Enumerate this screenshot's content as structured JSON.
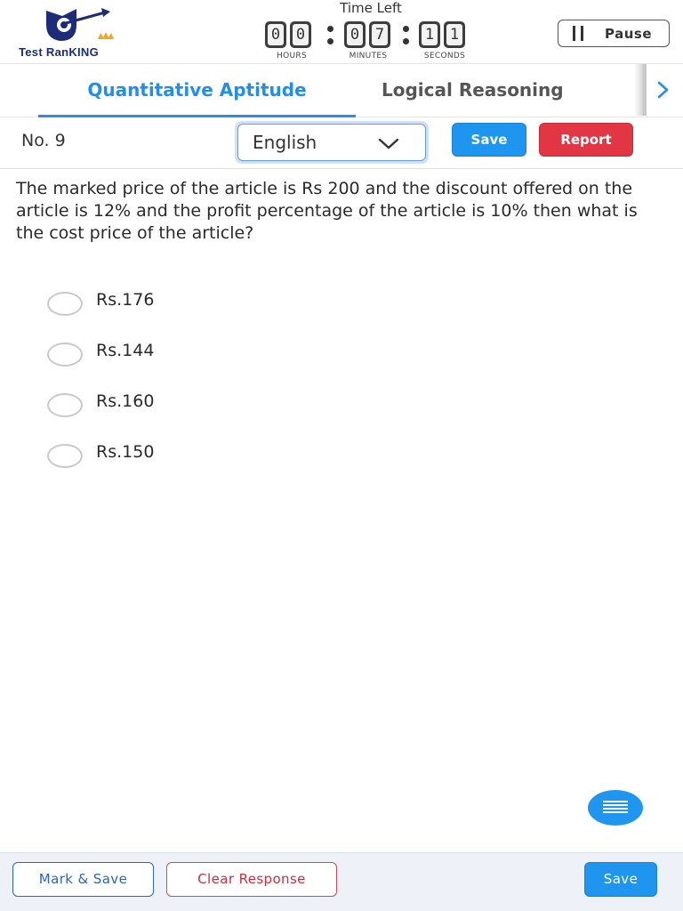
{
  "header": {
    "logo_text": "Test RanKING",
    "logo_icon": "target-arrow-logo",
    "timer": {
      "label": "Time Left",
      "hours": [
        "0",
        "0"
      ],
      "minutes": [
        "0",
        "7"
      ],
      "seconds": [
        "1",
        "1"
      ],
      "hours_label": "HOURS",
      "minutes_label": "MINUTES",
      "seconds_label": "SECONDS"
    },
    "pause_label": "Pause"
  },
  "tabs": {
    "items": [
      {
        "label": "Quantitative Aptitude",
        "active": true
      },
      {
        "label": "Logical Reasoning",
        "active": false
      }
    ],
    "next_icon": "chevron-right-icon"
  },
  "question_bar": {
    "number": "No. 9",
    "language": "English",
    "save_label": "Save",
    "report_label": "Report"
  },
  "question": {
    "text": "The marked price of the article is Rs 200 and the discount offered on the article is 12% and the profit percentage of the article is 10% then what is the cost price of the article?",
    "options": [
      "Rs.176",
      "Rs.144",
      "Rs.160",
      "Rs.150"
    ]
  },
  "footer": {
    "mark_save_label": "Mark & Save",
    "clear_label": "Clear Response",
    "save_label": "Save"
  },
  "colors": {
    "primary": "#1e96f0",
    "danger": "#e33645",
    "logo_navy": "#1d2c7a",
    "footer_bg": "#eef1f8"
  }
}
